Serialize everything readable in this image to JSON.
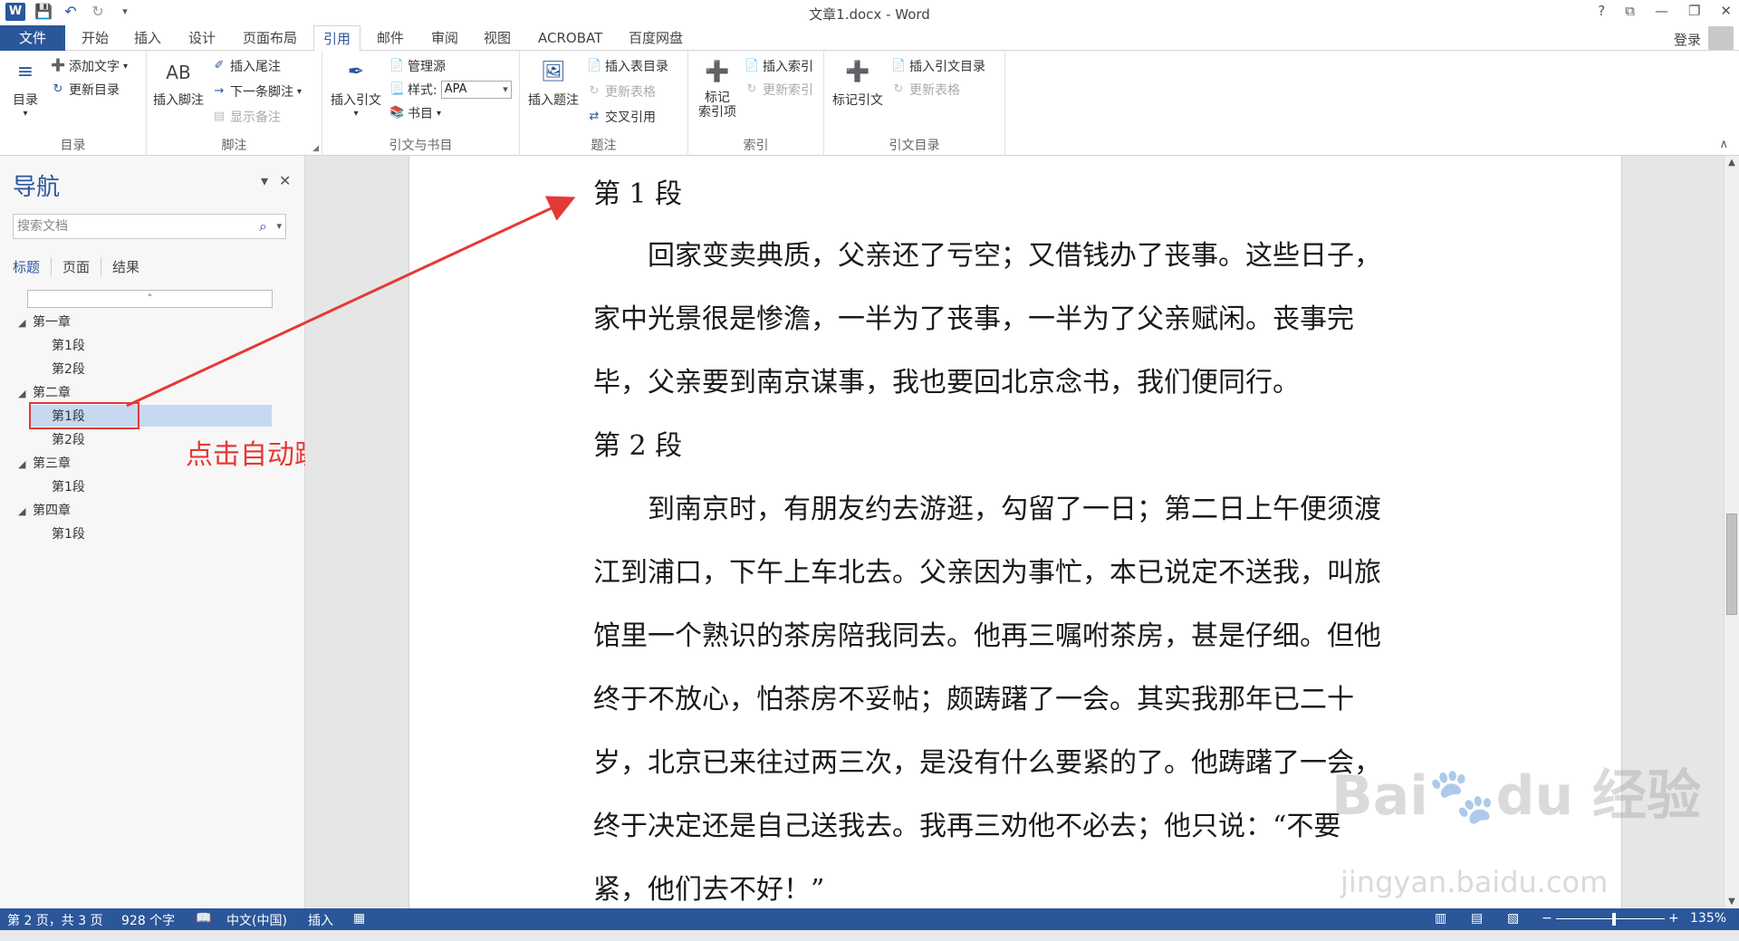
{
  "window": {
    "title": "文章1.docx - Word",
    "help": "?",
    "controls": [
      "⧉",
      "—",
      "❐",
      "✕"
    ]
  },
  "quick_access": [
    "save-icon",
    "undo-icon",
    "redo-icon",
    "customize-icon"
  ],
  "tabs": {
    "file": "文件",
    "items": [
      "开始",
      "插入",
      "设计",
      "页面布局",
      "引用",
      "邮件",
      "审阅",
      "视图",
      "ACROBAT",
      "百度网盘"
    ],
    "active": "引用",
    "login": "登录"
  },
  "ribbon": {
    "toc": {
      "label": "目录",
      "btn": "目录",
      "add_text": "添加文字",
      "update": "更新目录"
    },
    "footnote": {
      "label": "脚注",
      "insert_footnote": "插入脚注",
      "insert_endnote": "插入尾注",
      "next_footnote": "下一条脚注",
      "show_notes": "显示备注",
      "ab": "AB"
    },
    "citation": {
      "label": "引文与书目",
      "insert_citation": "插入引文",
      "manage_sources": "管理源",
      "style_label": "样式:",
      "style_value": "APA",
      "bibliography": "书目"
    },
    "caption": {
      "label": "题注",
      "insert_caption": "插入题注",
      "insert_toc_fig": "插入表目录",
      "update_table": "更新表格",
      "cross_ref": "交叉引用"
    },
    "index": {
      "label": "索引",
      "mark_entry": "标记\n索引项",
      "insert_index": "插入索引",
      "update_index": "更新索引"
    },
    "toa": {
      "label": "引文目录",
      "mark_citation": "标记引文",
      "insert_toa": "插入引文目录",
      "update_table": "更新表格"
    }
  },
  "nav": {
    "title": "导航",
    "search_placeholder": "搜索文档",
    "tabs": [
      "标题",
      "页面",
      "结果"
    ],
    "tree": [
      {
        "text": "第一章",
        "level": 1
      },
      {
        "text": "第1段",
        "level": 2
      },
      {
        "text": "第2段",
        "level": 2
      },
      {
        "text": "第二章",
        "level": 1
      },
      {
        "text": "第1段",
        "level": 2,
        "selected": true
      },
      {
        "text": "第2段",
        "level": 2
      },
      {
        "text": "第三章",
        "level": 1
      },
      {
        "text": "第1段",
        "level": 2
      },
      {
        "text": "第四章",
        "level": 1
      },
      {
        "text": "第1段",
        "level": 2
      }
    ],
    "callout": "点击自动跳转"
  },
  "document": {
    "lines": [
      "第 1 段",
      "　　回家变卖典质，父亲还了亏空；又借钱办了丧事。这些日子，",
      "家中光景很是惨澹，一半为了丧事，一半为了父亲赋闲。丧事完",
      "毕，父亲要到南京谋事，我也要回北京念书，我们便同行。",
      "第 2 段",
      "　　到南京时，有朋友约去游逛，勾留了一日；第二日上午便须渡",
      "江到浦口，下午上车北去。父亲因为事忙，本已说定不送我，叫旅",
      "馆里一个熟识的茶房陪我同去。他再三嘱咐茶房，甚是仔细。但他",
      "终于不放心，怕茶房不妥帖；颇踌躇了一会。其实我那年已二十",
      "岁，北京已来往过两三次，是没有什么要紧的了。他踌躇了一会，",
      "终于决定还是自己送我去。我再三劝他不必去；他只说：“不要",
      "紧，他们去不好！”"
    ]
  },
  "status": {
    "page": "第 2 页，共 3 页",
    "words": "928 个字",
    "lang": "中文(中国)",
    "mode": "插入",
    "zoom": "135%"
  },
  "watermark": {
    "main": "Bai du 经验",
    "sub": "jingyan.baidu.com"
  },
  "colors": {
    "brand": "#2b579a",
    "callout": "#e53935",
    "selection": "#c6d9f1"
  }
}
